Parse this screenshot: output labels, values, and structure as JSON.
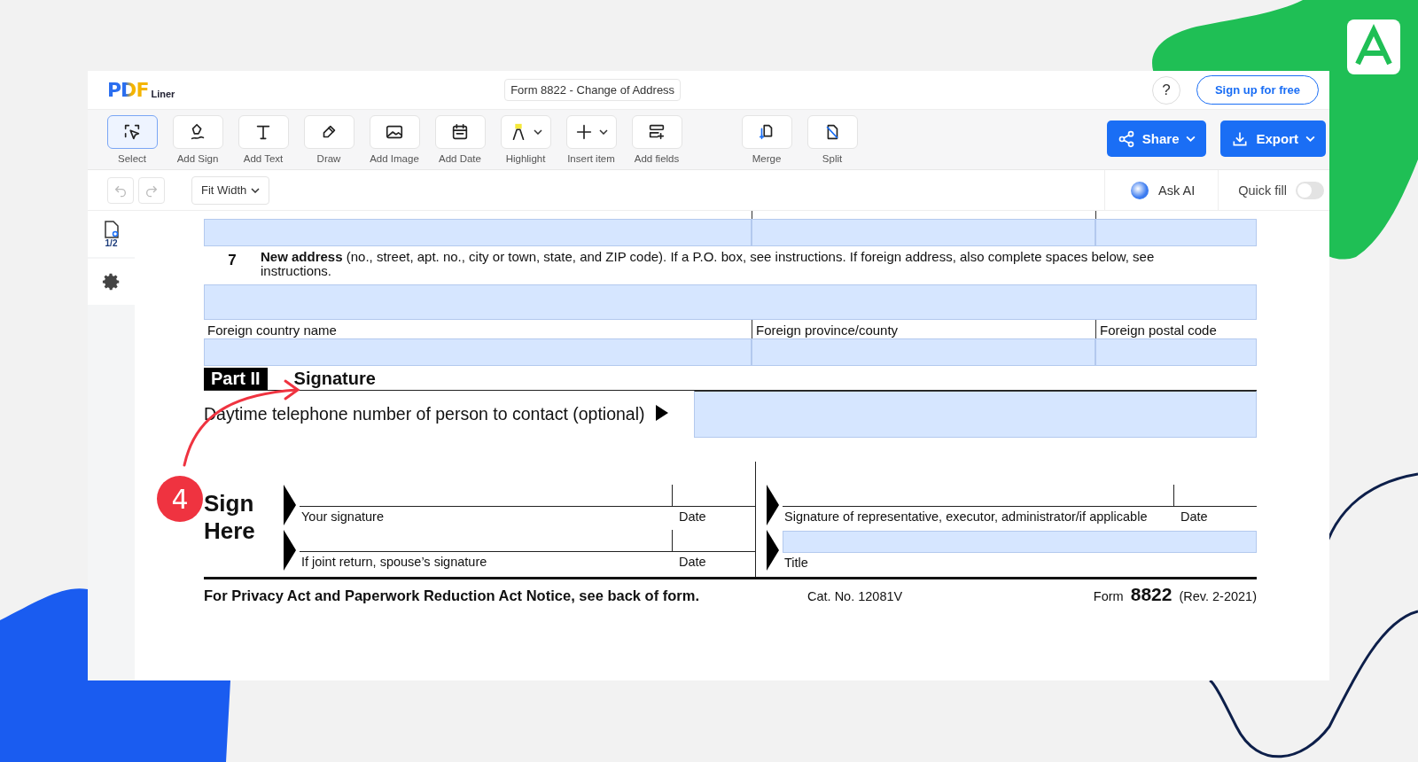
{
  "header": {
    "logo": "PDF",
    "logo_sub": "Liner",
    "title": "Form 8822 - Change of Address",
    "help": "?",
    "signup": "Sign up for free"
  },
  "toolbar": {
    "tools": [
      {
        "kind": "select",
        "label": "Select",
        "selected": true,
        "has_menu": false
      },
      {
        "kind": "sign",
        "label": "Add Sign",
        "selected": false,
        "has_menu": false
      },
      {
        "kind": "text",
        "label": "Add Text",
        "selected": false,
        "has_menu": false
      },
      {
        "kind": "draw",
        "label": "Draw",
        "selected": false,
        "has_menu": false
      },
      {
        "kind": "image",
        "label": "Add Image",
        "selected": false,
        "has_menu": false
      },
      {
        "kind": "date",
        "label": "Add Date",
        "selected": false,
        "has_menu": false
      },
      {
        "kind": "highlight",
        "label": "Highlight",
        "selected": false,
        "has_menu": true
      },
      {
        "kind": "insert",
        "label": "Insert item",
        "selected": false,
        "has_menu": true
      },
      {
        "kind": "fields",
        "label": "Add fields",
        "selected": false,
        "has_menu": false
      }
    ],
    "page_tools": [
      {
        "kind": "merge",
        "label": "Merge",
        "selected": false,
        "has_menu": false
      },
      {
        "kind": "split",
        "label": "Split",
        "selected": false,
        "has_menu": false
      }
    ],
    "share": "Share",
    "export": "Export"
  },
  "subbar": {
    "zoom": "Fit Width",
    "ask_ai": "Ask AI",
    "quick_fill": {
      "label": "Quick fill",
      "on": false
    }
  },
  "sidebar": {
    "page": "1/2"
  },
  "form": {
    "line7": {
      "number": "7",
      "text": "**New address** (no., street, apt. no., city or town, state, and ZIP code). If a P.O. box, see instructions. If foreign address, also complete spaces below, see instructions."
    },
    "foreign_labels": [
      "Foreign country name",
      "Foreign province/county",
      "Foreign postal code"
    ],
    "part": {
      "label": "Part II",
      "title": "Signature"
    },
    "phone_label": "Daytime telephone number of person to contact (optional)",
    "sign_heading": "Sign Here",
    "signature_lines": [
      {
        "label": "Your signature",
        "date": "Date"
      },
      {
        "label": "If joint return, spouse’s signature",
        "date": "Date"
      }
    ],
    "rep_signature": {
      "label": "Signature of representative, executor, administrator/if applicable",
      "date": "Date"
    },
    "title_label": "Title",
    "footer": {
      "notice": "For Privacy Act and Paperwork Reduction Act Notice, see back of form.",
      "cat": "Cat. No. 12081V",
      "form_word": "Form",
      "form_number": "8822",
      "rev": "(Rev. 2-2021)"
    }
  },
  "annotation": {
    "step": "4"
  }
}
